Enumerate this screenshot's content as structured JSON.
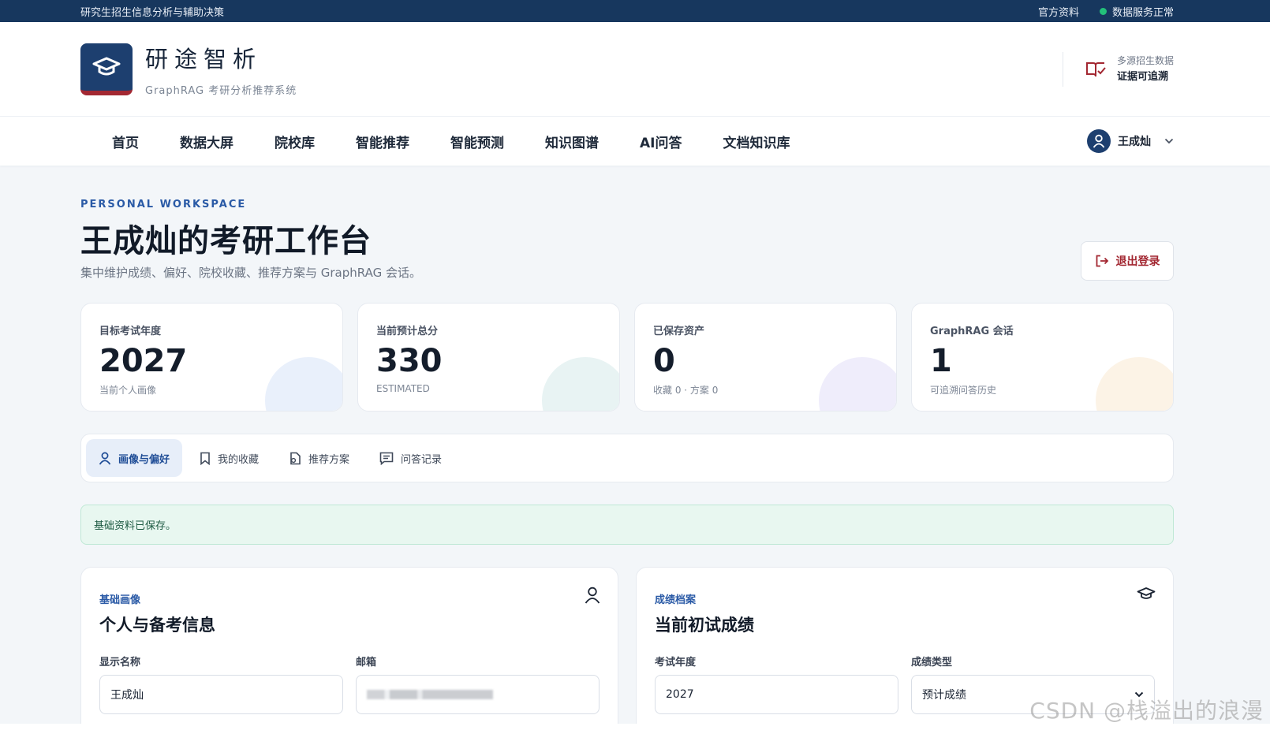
{
  "topbar": {
    "tagline": "研究生招生信息分析与辅助决策",
    "official_link": "官方资料",
    "service_status": "数据服务正常"
  },
  "brand": {
    "title": "研途智析",
    "subtitle": "GraphRAG 考研分析推荐系统"
  },
  "header_right": {
    "line1": "多源招生数据",
    "line2": "证据可追溯"
  },
  "nav": {
    "items": [
      "首页",
      "数据大屏",
      "院校库",
      "智能推荐",
      "智能预测",
      "知识图谱",
      "AI问答",
      "文档知识库"
    ],
    "user_name": "王成灿"
  },
  "page": {
    "eyebrow": "PERSONAL WORKSPACE",
    "title": "王成灿的考研工作台",
    "description": "集中维护成绩、偏好、院校收藏、推荐方案与 GraphRAG 会话。",
    "logout_label": "退出登录"
  },
  "stats": [
    {
      "label": "目标考试年度",
      "value": "2027",
      "sub": "当前个人画像",
      "accent": "#e9f0fb"
    },
    {
      "label": "当前预计总分",
      "value": "330",
      "sub": "ESTIMATED",
      "accent": "#e8f3f3"
    },
    {
      "label": "已保存资产",
      "value": "0",
      "sub": "收藏 0 · 方案 0",
      "accent": "#efedfb"
    },
    {
      "label": "GraphRAG 会话",
      "value": "1",
      "sub": "可追溯问答历史",
      "accent": "#fcf3e6"
    }
  ],
  "tabs": [
    {
      "label": "画像与偏好",
      "icon": "user-icon",
      "active": true
    },
    {
      "label": "我的收藏",
      "icon": "bookmark-icon",
      "active": false
    },
    {
      "label": "推荐方案",
      "icon": "document-icon",
      "active": false
    },
    {
      "label": "问答记录",
      "icon": "message-icon",
      "active": false
    }
  ],
  "alert": {
    "message": "基础资料已保存。"
  },
  "profile_panel": {
    "eyebrow": "基础画像",
    "title": "个人与备考信息",
    "display_name_label": "显示名称",
    "display_name_value": "王成灿",
    "email_label": "邮箱"
  },
  "score_panel": {
    "eyebrow": "成绩档案",
    "title": "当前初试成绩",
    "year_label": "考试年度",
    "year_value": "2027",
    "score_type_label": "成绩类型",
    "score_type_value": "预计成绩"
  },
  "watermark": "CSDN @栈溢出的浪漫",
  "colors": {
    "topbar": "#17375e",
    "brand_blue": "#1d3f6f",
    "brand_red": "#a32832",
    "accent_blue": "#2a5aa6",
    "status_green": "#23c07a"
  }
}
